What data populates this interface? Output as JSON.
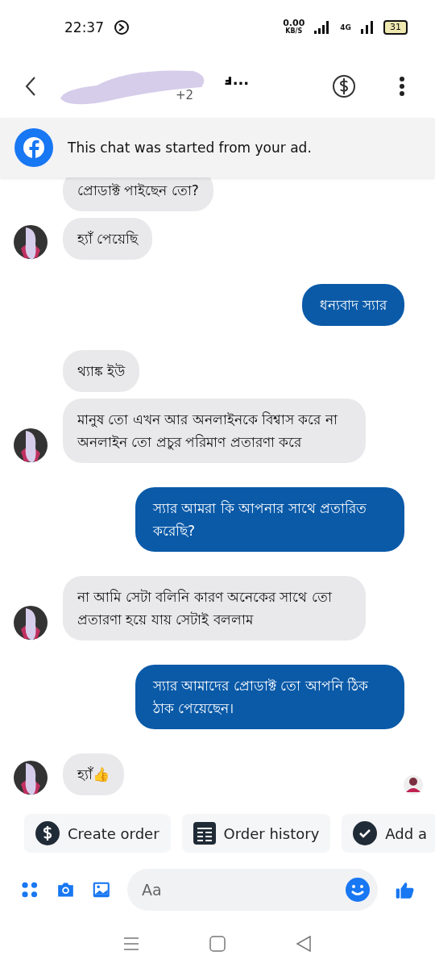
{
  "status_bar": {
    "time": "22:37",
    "speed_value": "0.00",
    "speed_unit": "KB/S",
    "network": "4G",
    "battery": "31"
  },
  "header": {
    "title": "ⅎ...",
    "subtitle": "+2"
  },
  "banner": {
    "text": "This chat was started from your ad."
  },
  "messages": [
    {
      "kind": "received",
      "text": "প্রোডাক্ট পাইছেন তো?",
      "avatar": false,
      "clipped": true,
      "seen": false
    },
    {
      "kind": "received",
      "text": "হ্যাঁ পেয়েছি",
      "avatar": true,
      "clipped": false,
      "seen": false
    },
    {
      "kind": "sent",
      "text": "ধন্যবাদ স্যার",
      "clipped": false,
      "seen": false
    },
    {
      "kind": "received",
      "text": "থ্যাঙ্ক ইউ",
      "avatar": false,
      "clipped": false,
      "seen": false
    },
    {
      "kind": "received",
      "text": "মানুষ তো এখন আর অনলাইনকে বিশ্বাস করে না অনলাইন তো প্রচুর পরিমাণ প্রতারণা করে",
      "avatar": true,
      "clipped": false,
      "seen": false
    },
    {
      "kind": "sent",
      "text": "স্যার আমরা কি আপনার সাথে প্রতারিত করেছি?",
      "clipped": false,
      "seen": false
    },
    {
      "kind": "received",
      "text": "না আমি সেটা বলিনি কারণ অনেকের সাথে তো প্রতারণা হয়ে যায় সেটাই বললাম",
      "avatar": true,
      "clipped": false,
      "seen": false
    },
    {
      "kind": "sent",
      "text": "স্যার আমাদের প্রোডাক্ট তো আপনি ঠিক ঠাক পেয়েছেন।",
      "clipped": false,
      "seen": false
    },
    {
      "kind": "received",
      "text": "হ্যাঁ👍",
      "avatar": true,
      "clipped": false,
      "seen": true
    }
  ],
  "quick_actions": [
    {
      "kind": "dollar",
      "label": "Create order"
    },
    {
      "kind": "list",
      "label": "Order history"
    },
    {
      "kind": "check",
      "label": "Add a"
    }
  ],
  "composer": {
    "placeholder": "Aa"
  }
}
